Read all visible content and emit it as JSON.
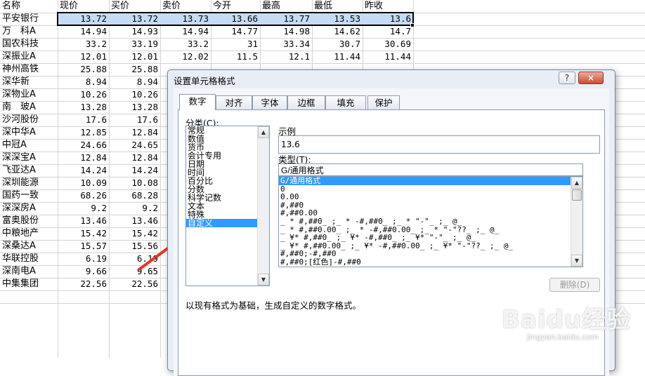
{
  "sheet": {
    "headers": [
      "名称",
      "现价",
      "买价",
      "卖价",
      "今开",
      "最高",
      "最低",
      "昨收"
    ],
    "rows": [
      [
        "平安银行",
        "13.72",
        "13.72",
        "13.73",
        "13.66",
        "13.77",
        "13.53",
        "13.6"
      ],
      [
        "万　科A",
        "14.94",
        "14.93",
        "14.94",
        "14.77",
        "14.98",
        "14.62",
        "14.7"
      ],
      [
        "国农科技",
        "33.2",
        "33.19",
        "33.2",
        "31",
        "33.34",
        "30.7",
        "30.69"
      ],
      [
        "深振业A",
        "12.01",
        "12.01",
        "12.02",
        "11.5",
        "12.1",
        "11.44",
        "11.44"
      ],
      [
        "神州高铁",
        "25.88",
        "25.88",
        "",
        "",
        "",
        "",
        ""
      ],
      [
        "深华新",
        "8.94",
        "8.94",
        "",
        "",
        "",
        "",
        ""
      ],
      [
        "深物业A",
        "10.26",
        "10.26",
        "",
        "",
        "",
        "",
        ""
      ],
      [
        "南　玻A",
        "13.28",
        "13.28",
        "",
        "",
        "",
        "",
        ""
      ],
      [
        "沙河股份",
        "17.6",
        "17.6",
        "",
        "",
        "",
        "",
        ""
      ],
      [
        "深中华A",
        "12.85",
        "12.84",
        "",
        "",
        "",
        "",
        ""
      ],
      [
        "中冠A",
        "24.66",
        "24.65",
        "",
        "",
        "",
        "",
        ""
      ],
      [
        "深深宝A",
        "12.84",
        "12.84",
        "",
        "",
        "",
        "",
        ""
      ],
      [
        "飞亚达A",
        "14.24",
        "14.24",
        "",
        "",
        "",
        "",
        ""
      ],
      [
        "深圳能源",
        "10.09",
        "10.08",
        "",
        "",
        "",
        "",
        ""
      ],
      [
        "国药一致",
        "68.26",
        "68.28",
        "",
        "",
        "",
        "",
        ""
      ],
      [
        "深深房A",
        "9.2",
        "9.2",
        "",
        "",
        "",
        "",
        ""
      ],
      [
        "富奥股份",
        "13.46",
        "13.46",
        "",
        "",
        "",
        "",
        ""
      ],
      [
        "中粮地产",
        "15.42",
        "15.42",
        "",
        "",
        "",
        "",
        ""
      ],
      [
        "深桑达A",
        "15.57",
        "15.56",
        "",
        "",
        "",
        "",
        ""
      ],
      [
        "华联控股",
        "6.19",
        "6.19",
        "",
        "",
        "",
        "",
        ""
      ],
      [
        "深南电A",
        "9.66",
        "9.65",
        "",
        "",
        "",
        "",
        ""
      ],
      [
        "中集集团",
        "22.56",
        "22.56",
        "",
        "",
        "",
        "",
        ""
      ]
    ]
  },
  "dialog": {
    "title": "设置单元格格式",
    "help_label": "?",
    "close_label": "×",
    "tabs": [
      "数字",
      "对齐",
      "字体",
      "边框",
      "填充",
      "保护"
    ],
    "category_label": "分类(C):",
    "categories": [
      "常规",
      "数值",
      "货币",
      "会计专用",
      "日期",
      "时间",
      "百分比",
      "分数",
      "科学记数",
      "文本",
      "特殊",
      "自定义"
    ],
    "selected_category": "自定义",
    "sample_label": "示例",
    "sample_value": "13.6",
    "type_label": "类型(T):",
    "type_value": "G/通用格式",
    "type_list": [
      "G/通用格式",
      "0",
      "0.00",
      "#,##0",
      "#,##0.00",
      "_ * #,##0_ ;_ * -#,##0_ ;_ * \"-\"_ ;_ @_",
      "_ * #,##0.00_ ;_ * -#,##0.00_ ;_ * \"-\"??_ ;_ @_",
      "_ ¥* #,##0_ ;_ ¥* -#,##0_ ;_ ¥* \"-\"_ ;_ @_",
      "_ ¥* #,##0.00_ ;_ ¥* -#,##0.00_ ;_ ¥* \"-\"??_ ;_ @_",
      "#,##0;-#,##0",
      "#,##0;[红色]-#,##0"
    ],
    "delete_label": "删除(D)",
    "description": "以现有格式为基础，生成自定义的数字格式。"
  },
  "watermark": {
    "brand": "Baidu经验",
    "url": "jingyan.baidu.com"
  },
  "colors": {
    "selection_fill": "#c6dcf4",
    "list_highlight": "#3399ff",
    "arrow": "#e8332a"
  }
}
